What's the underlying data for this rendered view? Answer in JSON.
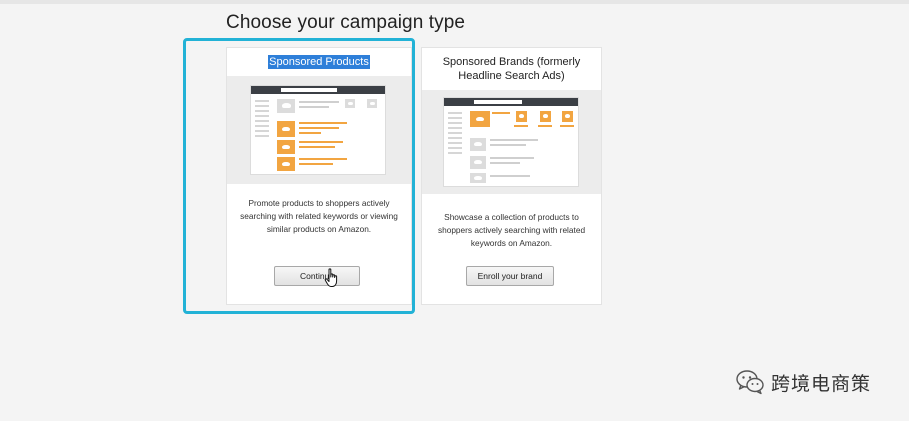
{
  "page": {
    "title": "Choose your campaign type"
  },
  "campaigns": [
    {
      "title": "Sponsored Products",
      "description": "Promote products to shoppers actively searching with related keywords or viewing similar products on Amazon.",
      "button_label": "Continue",
      "selected": true
    },
    {
      "title": "Sponsored Brands (formerly Headline Search Ads)",
      "description": "Showcase a collection of products to shoppers actively searching with related keywords on Amazon.",
      "button_label": "Enroll your brand",
      "selected": false
    }
  ],
  "watermark": {
    "text": "跨境电商策",
    "icon": "wechat-logo-icon"
  },
  "colors": {
    "selection_outline": "#22b2d6",
    "text_highlight": "#2e7fd9",
    "preview_accent": "#f2a541"
  }
}
